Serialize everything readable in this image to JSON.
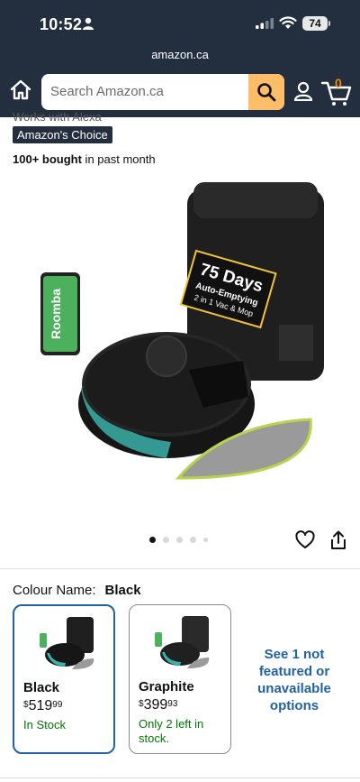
{
  "status_bar": {
    "time": "10:52",
    "battery": "74"
  },
  "url": "amazon.ca",
  "header": {
    "search_placeholder": "Search Amazon.ca",
    "cart_count": "0"
  },
  "product": {
    "alexa_text": "Works with Alexa",
    "badge": "Amazon's Choice",
    "bought_bold": "100+ bought",
    "bought_rest": " in past month",
    "image_text": {
      "phone_label": "Roomba",
      "station_line1": "75 Days",
      "station_line2": "Auto-Emptying",
      "station_line3": "2 in 1 Vac & Mop"
    },
    "carousel": {
      "count": 5,
      "active": 0
    }
  },
  "colour": {
    "label": "Colour Name:",
    "value": "Black",
    "options": [
      {
        "name": "Black",
        "currency": "$",
        "price_whole": "519",
        "price_fraction": "99",
        "stock": "In Stock"
      },
      {
        "name": "Graphite",
        "currency": "$",
        "price_whole": "399",
        "price_fraction": "93",
        "stock": "Only 2 left in stock."
      }
    ],
    "see_more": "See 1 not featured or unavailable options"
  },
  "colors": {
    "nav": "#232f3e",
    "search_button": "#febd69",
    "link": "#2162a1",
    "in_stock": "#007600"
  }
}
